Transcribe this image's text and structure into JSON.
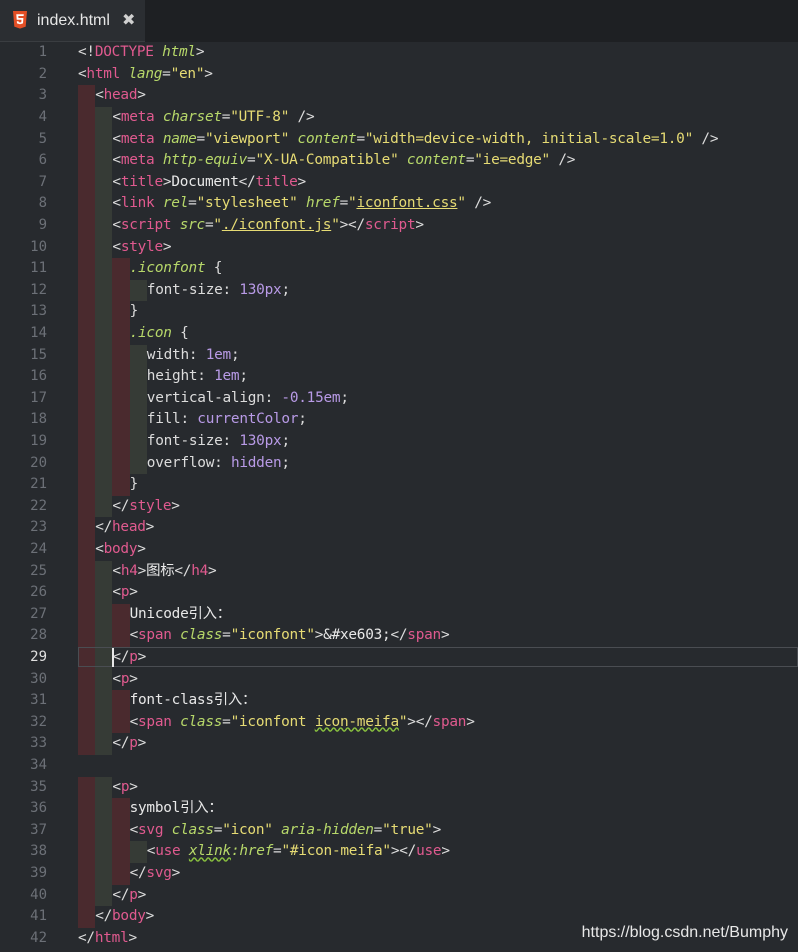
{
  "tab": {
    "icon": "html5-icon",
    "title": "index.html",
    "close_glyph": "✖"
  },
  "editor": {
    "active_line": 29,
    "lines": [
      [
        [
          "punct",
          "<!"
        ],
        [
          "tag",
          "DOCTYPE"
        ],
        [
          "punct",
          " "
        ],
        [
          "attr",
          "html"
        ],
        [
          "punct",
          ">"
        ]
      ],
      [
        [
          "punct",
          "<"
        ],
        [
          "tag",
          "html"
        ],
        [
          "punct",
          " "
        ],
        [
          "attr",
          "lang"
        ],
        [
          "punct",
          "="
        ],
        [
          "str",
          "\"en\""
        ],
        [
          "punct",
          ">"
        ]
      ],
      [
        [
          "punct",
          "<"
        ],
        [
          "tag",
          "head"
        ],
        [
          "punct",
          ">"
        ]
      ],
      [
        [
          "punct",
          "<"
        ],
        [
          "tag",
          "meta"
        ],
        [
          "punct",
          " "
        ],
        [
          "attr",
          "charset"
        ],
        [
          "punct",
          "="
        ],
        [
          "str",
          "\"UTF-8\""
        ],
        [
          "punct",
          " />"
        ]
      ],
      [
        [
          "punct",
          "<"
        ],
        [
          "tag",
          "meta"
        ],
        [
          "punct",
          " "
        ],
        [
          "attr",
          "name"
        ],
        [
          "punct",
          "="
        ],
        [
          "str",
          "\"viewport\""
        ],
        [
          "punct",
          " "
        ],
        [
          "attr",
          "content"
        ],
        [
          "punct",
          "="
        ],
        [
          "str",
          "\"width=device-width, initial-scale=1.0\""
        ],
        [
          "punct",
          " />"
        ]
      ],
      [
        [
          "punct",
          "<"
        ],
        [
          "tag",
          "meta"
        ],
        [
          "punct",
          " "
        ],
        [
          "attr",
          "http-equiv"
        ],
        [
          "punct",
          "="
        ],
        [
          "str",
          "\"X-UA-Compatible\""
        ],
        [
          "punct",
          " "
        ],
        [
          "attr",
          "content"
        ],
        [
          "punct",
          "="
        ],
        [
          "str",
          "\"ie=edge\""
        ],
        [
          "punct",
          " />"
        ]
      ],
      [
        [
          "punct",
          "<"
        ],
        [
          "tag",
          "title"
        ],
        [
          "punct",
          ">"
        ],
        [
          "text",
          "Document"
        ],
        [
          "punct",
          "</"
        ],
        [
          "tag",
          "title"
        ],
        [
          "punct",
          ">"
        ]
      ],
      [
        [
          "punct",
          "<"
        ],
        [
          "tag",
          "link"
        ],
        [
          "punct",
          " "
        ],
        [
          "attr",
          "rel"
        ],
        [
          "punct",
          "="
        ],
        [
          "str",
          "\"stylesheet\""
        ],
        [
          "punct",
          " "
        ],
        [
          "attr",
          "href"
        ],
        [
          "punct",
          "="
        ],
        [
          "str",
          "\""
        ],
        [
          "str-u",
          "iconfont.css"
        ],
        [
          "str",
          "\""
        ],
        [
          "punct",
          " />"
        ]
      ],
      [
        [
          "punct",
          "<"
        ],
        [
          "tag",
          "script"
        ],
        [
          "punct",
          " "
        ],
        [
          "attr",
          "src"
        ],
        [
          "punct",
          "="
        ],
        [
          "str",
          "\""
        ],
        [
          "str-u",
          "./iconfont.js"
        ],
        [
          "str",
          "\""
        ],
        [
          "punct",
          "></"
        ],
        [
          "tag",
          "script"
        ],
        [
          "punct",
          ">"
        ]
      ],
      [
        [
          "punct",
          "<"
        ],
        [
          "tag",
          "style"
        ],
        [
          "punct",
          ">"
        ]
      ],
      [
        [
          "sel",
          ".iconfont"
        ],
        [
          "punct",
          " {"
        ]
      ],
      [
        [
          "prop",
          "font-size"
        ],
        [
          "punct",
          ": "
        ],
        [
          "val",
          "130px"
        ],
        [
          "punct",
          ";"
        ]
      ],
      [
        [
          "punct",
          "}"
        ]
      ],
      [
        [
          "sel",
          ".icon"
        ],
        [
          "punct",
          " {"
        ]
      ],
      [
        [
          "prop",
          "width"
        ],
        [
          "punct",
          ": "
        ],
        [
          "val",
          "1em"
        ],
        [
          "punct",
          ";"
        ]
      ],
      [
        [
          "prop",
          "height"
        ],
        [
          "punct",
          ": "
        ],
        [
          "val",
          "1em"
        ],
        [
          "punct",
          ";"
        ]
      ],
      [
        [
          "prop",
          "vertical-align"
        ],
        [
          "punct",
          ": "
        ],
        [
          "val",
          "-0.15em"
        ],
        [
          "punct",
          ";"
        ]
      ],
      [
        [
          "prop",
          "fill"
        ],
        [
          "punct",
          ": "
        ],
        [
          "val",
          "currentColor"
        ],
        [
          "punct",
          ";"
        ]
      ],
      [
        [
          "prop",
          "font-size"
        ],
        [
          "punct",
          ": "
        ],
        [
          "val",
          "130px"
        ],
        [
          "punct",
          ";"
        ]
      ],
      [
        [
          "prop",
          "overflow"
        ],
        [
          "punct",
          ": "
        ],
        [
          "val",
          "hidden"
        ],
        [
          "punct",
          ";"
        ]
      ],
      [
        [
          "punct",
          "}"
        ]
      ],
      [
        [
          "punct",
          "</"
        ],
        [
          "tag",
          "style"
        ],
        [
          "punct",
          ">"
        ]
      ],
      [
        [
          "punct",
          "</"
        ],
        [
          "tag",
          "head"
        ],
        [
          "punct",
          ">"
        ]
      ],
      [
        [
          "punct",
          "<"
        ],
        [
          "tag",
          "body"
        ],
        [
          "punct",
          ">"
        ]
      ],
      [
        [
          "punct",
          "<"
        ],
        [
          "tag",
          "h4"
        ],
        [
          "punct",
          ">"
        ],
        [
          "text",
          "图标"
        ],
        [
          "punct",
          "</"
        ],
        [
          "tag",
          "h4"
        ],
        [
          "punct",
          ">"
        ]
      ],
      [
        [
          "punct",
          "<"
        ],
        [
          "tag",
          "p"
        ],
        [
          "punct",
          ">"
        ]
      ],
      [
        [
          "text",
          "Unicode引入："
        ]
      ],
      [
        [
          "punct",
          "<"
        ],
        [
          "tag",
          "span"
        ],
        [
          "punct",
          " "
        ],
        [
          "attr",
          "class"
        ],
        [
          "punct",
          "="
        ],
        [
          "str",
          "\"iconfont\""
        ],
        [
          "punct",
          ">"
        ],
        [
          "ent",
          "&#xe603;"
        ],
        [
          "punct",
          "</"
        ],
        [
          "tag",
          "span"
        ],
        [
          "punct",
          ">"
        ]
      ],
      [
        [
          "punct",
          "</"
        ],
        [
          "tag",
          "p"
        ],
        [
          "punct",
          ">"
        ]
      ],
      [
        [
          "punct",
          "<"
        ],
        [
          "tag",
          "p"
        ],
        [
          "punct",
          ">"
        ]
      ],
      [
        [
          "text",
          "font-class引入："
        ]
      ],
      [
        [
          "punct",
          "<"
        ],
        [
          "tag",
          "span"
        ],
        [
          "punct",
          " "
        ],
        [
          "attr",
          "class"
        ],
        [
          "punct",
          "="
        ],
        [
          "str",
          "\"iconfont "
        ],
        [
          "squig",
          "icon-meifa"
        ],
        [
          "str",
          "\""
        ],
        [
          "punct",
          "></"
        ],
        [
          "tag",
          "span"
        ],
        [
          "punct",
          ">"
        ]
      ],
      [
        [
          "punct",
          "</"
        ],
        [
          "tag",
          "p"
        ],
        [
          "punct",
          ">"
        ]
      ],
      [],
      [
        [
          "punct",
          "<"
        ],
        [
          "tag",
          "p"
        ],
        [
          "punct",
          ">"
        ]
      ],
      [
        [
          "text",
          "symbol引入："
        ]
      ],
      [
        [
          "punct",
          "<"
        ],
        [
          "tag",
          "svg"
        ],
        [
          "punct",
          " "
        ],
        [
          "attr",
          "class"
        ],
        [
          "punct",
          "="
        ],
        [
          "str",
          "\"icon\""
        ],
        [
          "punct",
          " "
        ],
        [
          "attr",
          "aria-hidden"
        ],
        [
          "punct",
          "="
        ],
        [
          "str",
          "\"true\""
        ],
        [
          "punct",
          ">"
        ]
      ],
      [
        [
          "punct",
          "<"
        ],
        [
          "tag",
          "use"
        ],
        [
          "punct",
          " "
        ],
        [
          "attr-squig",
          "xlink"
        ],
        [
          "attr",
          ":href"
        ],
        [
          "punct",
          "="
        ],
        [
          "str",
          "\"#icon-meifa\""
        ],
        [
          "punct",
          "></"
        ],
        [
          "tag",
          "use"
        ],
        [
          "punct",
          ">"
        ]
      ],
      [
        [
          "punct",
          "</"
        ],
        [
          "tag",
          "svg"
        ],
        [
          "punct",
          ">"
        ]
      ],
      [
        [
          "punct",
          "</"
        ],
        [
          "tag",
          "p"
        ],
        [
          "punct",
          ">"
        ]
      ],
      [
        [
          "punct",
          "</"
        ],
        [
          "tag",
          "body"
        ],
        [
          "punct",
          ">"
        ]
      ],
      [
        [
          "punct",
          "</"
        ],
        [
          "tag",
          "html"
        ],
        [
          "punct",
          ">"
        ]
      ]
    ]
  },
  "watermark": "https://blog.csdn.net/Bumphy"
}
